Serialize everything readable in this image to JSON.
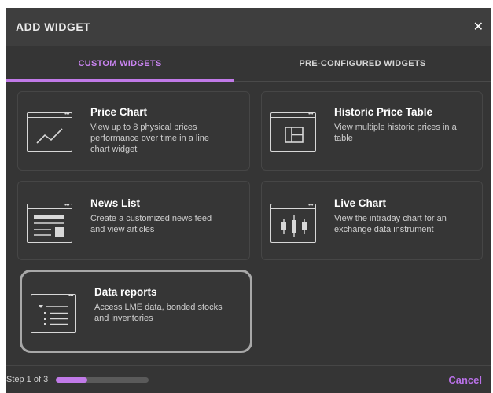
{
  "dialog": {
    "title": "ADD WIDGET",
    "close_icon": "close-icon"
  },
  "tabs": [
    {
      "label": "CUSTOM WIDGETS",
      "active": true
    },
    {
      "label": "PRE-CONFIGURED WIDGETS",
      "active": false
    }
  ],
  "widgets": [
    {
      "title": "Price Chart",
      "description": "View up to 8 physical prices performance over time in a line chart widget",
      "icon": "line-chart-icon"
    },
    {
      "title": "Historic Price Table",
      "description": "View multiple historic prices in a table",
      "icon": "table-icon"
    },
    {
      "title": "News List",
      "description": "Create a customized news feed and view articles",
      "icon": "news-list-icon"
    },
    {
      "title": "Live Chart",
      "description": "View the intraday chart for an exchange data instrument",
      "icon": "candlestick-chart-icon"
    },
    {
      "title": "Data reports",
      "description": "Access LME data, bonded stocks and inventories",
      "icon": "data-report-icon",
      "selected": true
    }
  ],
  "footer": {
    "step_text": "Step 1 of 3",
    "progress_fraction": 0.333,
    "cancel_label": "Cancel"
  },
  "colors": {
    "accent": "#c17ae8",
    "background": "#353535",
    "header": "#3e3e3e"
  }
}
